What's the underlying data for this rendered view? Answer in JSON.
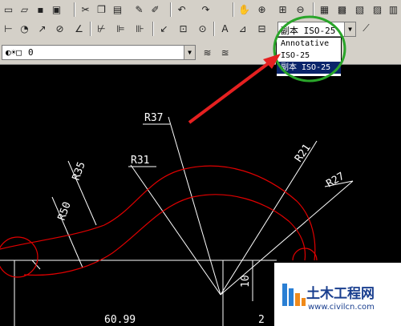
{
  "toolbar_row1": {
    "icons": [
      "new-icon",
      "open-icon",
      "save-icon",
      "plot-icon",
      "preview-icon",
      "publish-icon",
      "cut-icon",
      "copy-icon",
      "paste-icon",
      "match-properties-icon",
      "block-editor-icon",
      "undo-icon",
      "redo-icon",
      "pan-icon",
      "zoom-realtime-icon",
      "zoom-window-icon",
      "zoom-previous-icon",
      "properties-icon",
      "design-center-icon",
      "tool-palettes-icon",
      "sheet-set-icon",
      "markup-icon",
      "calculator-icon"
    ]
  },
  "toolbar_row2": {
    "dim_style_combo": {
      "value": "副本 ISO-25"
    },
    "dropdown_options": [
      "Annotative",
      "ISO-25",
      "副本 ISO-25"
    ],
    "selected_index": 2
  },
  "toolbar_row3": {
    "layer_combo": {
      "value": "0"
    }
  },
  "drawing": {
    "dimensions": [
      "R37",
      "R31",
      "R35",
      "R50",
      "R21",
      "R27",
      "10",
      "60.99",
      "2"
    ]
  },
  "watermark": {
    "title": "土木工程网",
    "url": "www.civilcn.com"
  },
  "colors": {
    "toolbar_bg": "#d4d0c8",
    "canvas_bg": "#000000",
    "curve": "#e00000",
    "dim": "#ffffff",
    "highlight_circle": "#2aa52a",
    "arrow": "#e52020",
    "selection": "#0a246a"
  }
}
